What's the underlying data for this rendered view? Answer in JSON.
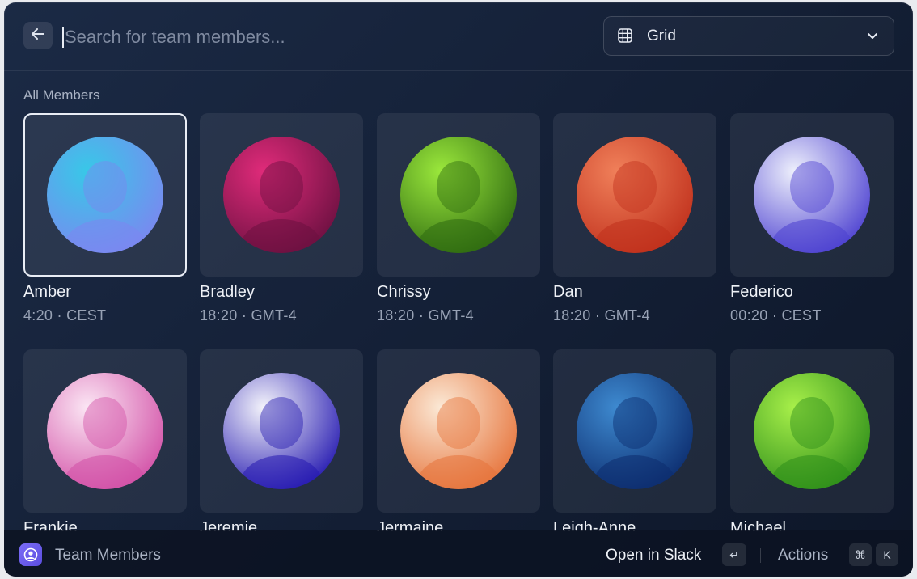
{
  "search": {
    "placeholder": "Search for team members...",
    "value": ""
  },
  "view_select": {
    "value": "Grid"
  },
  "section_title": "All Members",
  "members": [
    {
      "name": "Amber",
      "time": "4:20 · CEST",
      "color1": "#38c8e8",
      "color2": "#7c86f0"
    },
    {
      "name": "Bradley",
      "time": "18:20 · GMT-4",
      "color1": "#e02b7a",
      "color2": "#6b1040"
    },
    {
      "name": "Chrissy",
      "time": "18:20 · GMT-4",
      "color1": "#9be83c",
      "color2": "#2e6a10"
    },
    {
      "name": "Dan",
      "time": "18:20 · GMT-4",
      "color1": "#f0805a",
      "color2": "#c0301c"
    },
    {
      "name": "Federico",
      "time": "00:20 · CEST",
      "color1": "#eef0fc",
      "color2": "#4b3fd0"
    },
    {
      "name": "Frankie",
      "time": "",
      "color1": "#fbe6f4",
      "color2": "#d24fa6"
    },
    {
      "name": "Jeremie",
      "time": "",
      "color1": "#f4f4fb",
      "color2": "#2418b0"
    },
    {
      "name": "Jermaine",
      "time": "",
      "color1": "#fbe9d6",
      "color2": "#e6733a"
    },
    {
      "name": "Leigh-Anne",
      "time": "",
      "color1": "#3e8ad0",
      "color2": "#0c2c6e"
    },
    {
      "name": "Michael",
      "time": "",
      "color1": "#a8f04a",
      "color2": "#2e8e1a"
    }
  ],
  "footer": {
    "app_name": "Team Members",
    "primary_action": "Open in Slack",
    "enter_key": "↵",
    "actions_label": "Actions",
    "shortcut_modifier": "⌘",
    "shortcut_key": "K"
  }
}
